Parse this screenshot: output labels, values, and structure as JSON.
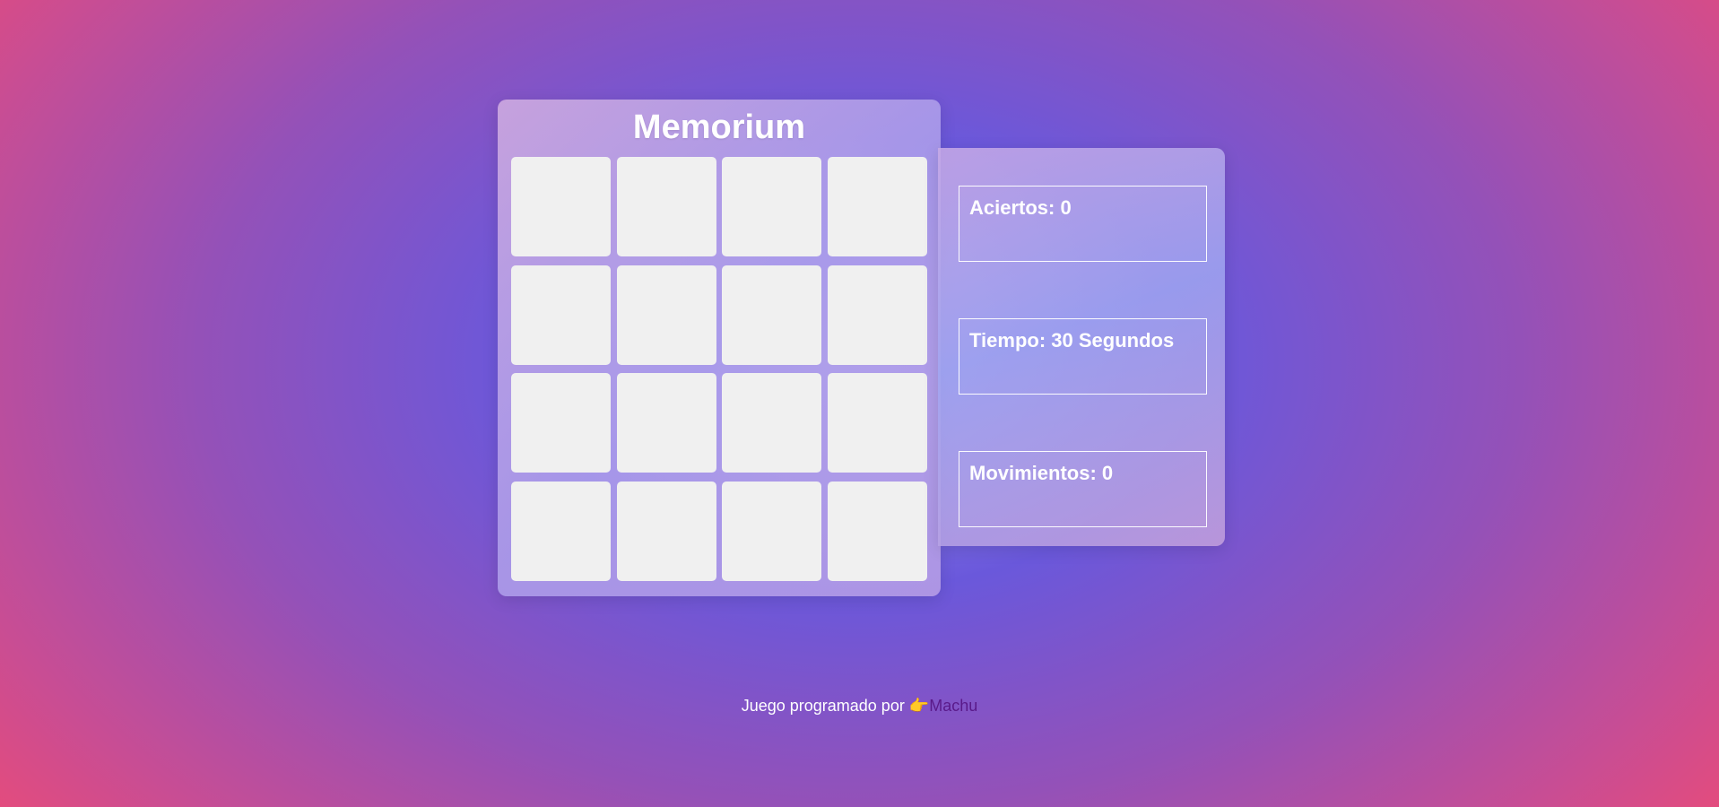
{
  "game": {
    "title": "Memorium",
    "cards": [
      "",
      "",
      "",
      "",
      "",
      "",
      "",
      "",
      "",
      "",
      "",
      "",
      "",
      "",
      "",
      ""
    ]
  },
  "stats": {
    "hits": "Aciertos: 0",
    "time": "Tiempo: 30 Segundos",
    "moves": "Movimientos: 0"
  },
  "footer": {
    "text": "Juego programado por ",
    "emoji": "👉",
    "author": "Machu"
  }
}
